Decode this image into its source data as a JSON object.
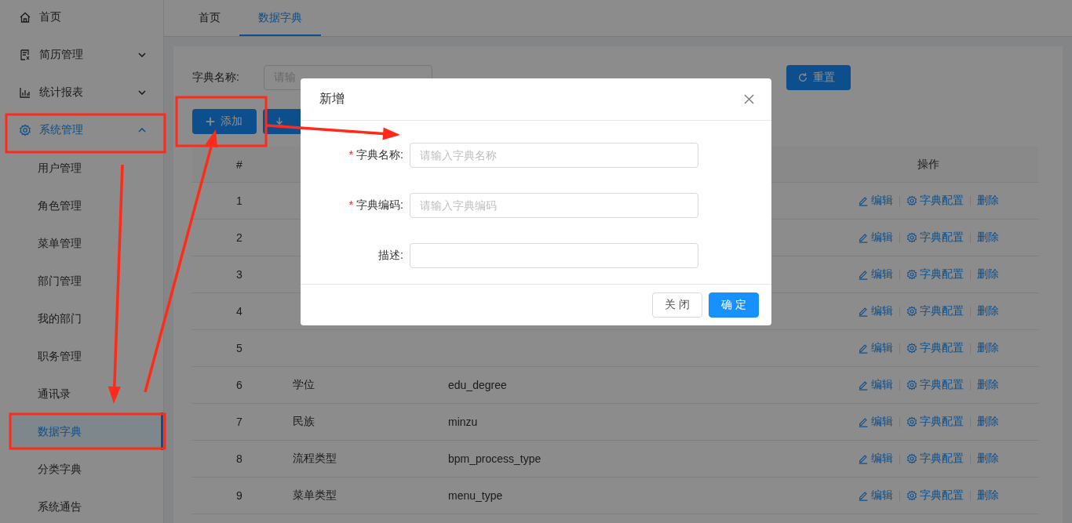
{
  "sidebar": {
    "items": [
      {
        "label": "首页",
        "selected": false
      },
      {
        "label": "简历管理",
        "selected": false,
        "expanded": false
      },
      {
        "label": "统计报表",
        "selected": false,
        "expanded": false
      },
      {
        "label": "系统管理",
        "selected": true,
        "expanded": true,
        "children": [
          {
            "label": "用户管理",
            "selected": false
          },
          {
            "label": "角色管理",
            "selected": false
          },
          {
            "label": "菜单管理",
            "selected": false
          },
          {
            "label": "部门管理",
            "selected": false
          },
          {
            "label": "我的部门",
            "selected": false
          },
          {
            "label": "职务管理",
            "selected": false
          },
          {
            "label": "通讯录",
            "selected": false
          },
          {
            "label": "数据字典",
            "selected": true
          },
          {
            "label": "分类字典",
            "selected": false
          },
          {
            "label": "系统通告",
            "selected": false
          }
        ]
      }
    ]
  },
  "tabs": [
    {
      "label": "首页",
      "selected": false
    },
    {
      "label": "数据字典",
      "selected": true
    }
  ],
  "search": {
    "name_label": "字典名称:",
    "name_placeholder": "请输",
    "reset_button": "重置"
  },
  "toolbar": {
    "add_button": "添加"
  },
  "table": {
    "columns": {
      "index": "#",
      "actions": "操作"
    },
    "rows": [
      {
        "index": "1",
        "actions": [
          "编辑",
          "字典配置",
          "删除"
        ]
      },
      {
        "index": "2",
        "actions": [
          "编辑",
          "字典配置",
          "删除"
        ]
      },
      {
        "index": "3",
        "actions": [
          "编辑",
          "字典配置",
          "删除"
        ]
      },
      {
        "index": "4",
        "actions": [
          "编辑",
          "字典配置",
          "删除"
        ]
      },
      {
        "index": "5",
        "actions": [
          "编辑",
          "字典配置",
          "删除"
        ]
      },
      {
        "index": "6",
        "name": "学位",
        "code": "edu_degree",
        "actions": [
          "编辑",
          "字典配置",
          "删除"
        ]
      },
      {
        "index": "7",
        "name": "民族",
        "code": "minzu",
        "actions": [
          "编辑",
          "字典配置",
          "删除"
        ]
      },
      {
        "index": "8",
        "name": "流程类型",
        "code": "bpm_process_type",
        "actions": [
          "编辑",
          "字典配置",
          "删除"
        ]
      },
      {
        "index": "9",
        "name": "菜单类型",
        "code": "menu_type",
        "actions": [
          "编辑",
          "字典配置",
          "删除"
        ]
      }
    ]
  },
  "dialog": {
    "title": "新增",
    "fields": [
      {
        "label": "字典名称:",
        "required_mark": "*",
        "placeholder": "请输入字典名称"
      },
      {
        "label": "字典编码:",
        "required_mark": "*",
        "placeholder": "请输入字典编码"
      },
      {
        "label": "描述:"
      }
    ],
    "buttons": [
      {
        "label": "关 闭",
        "kind": "secondary"
      },
      {
        "label": "确 定",
        "kind": "primary"
      }
    ]
  }
}
